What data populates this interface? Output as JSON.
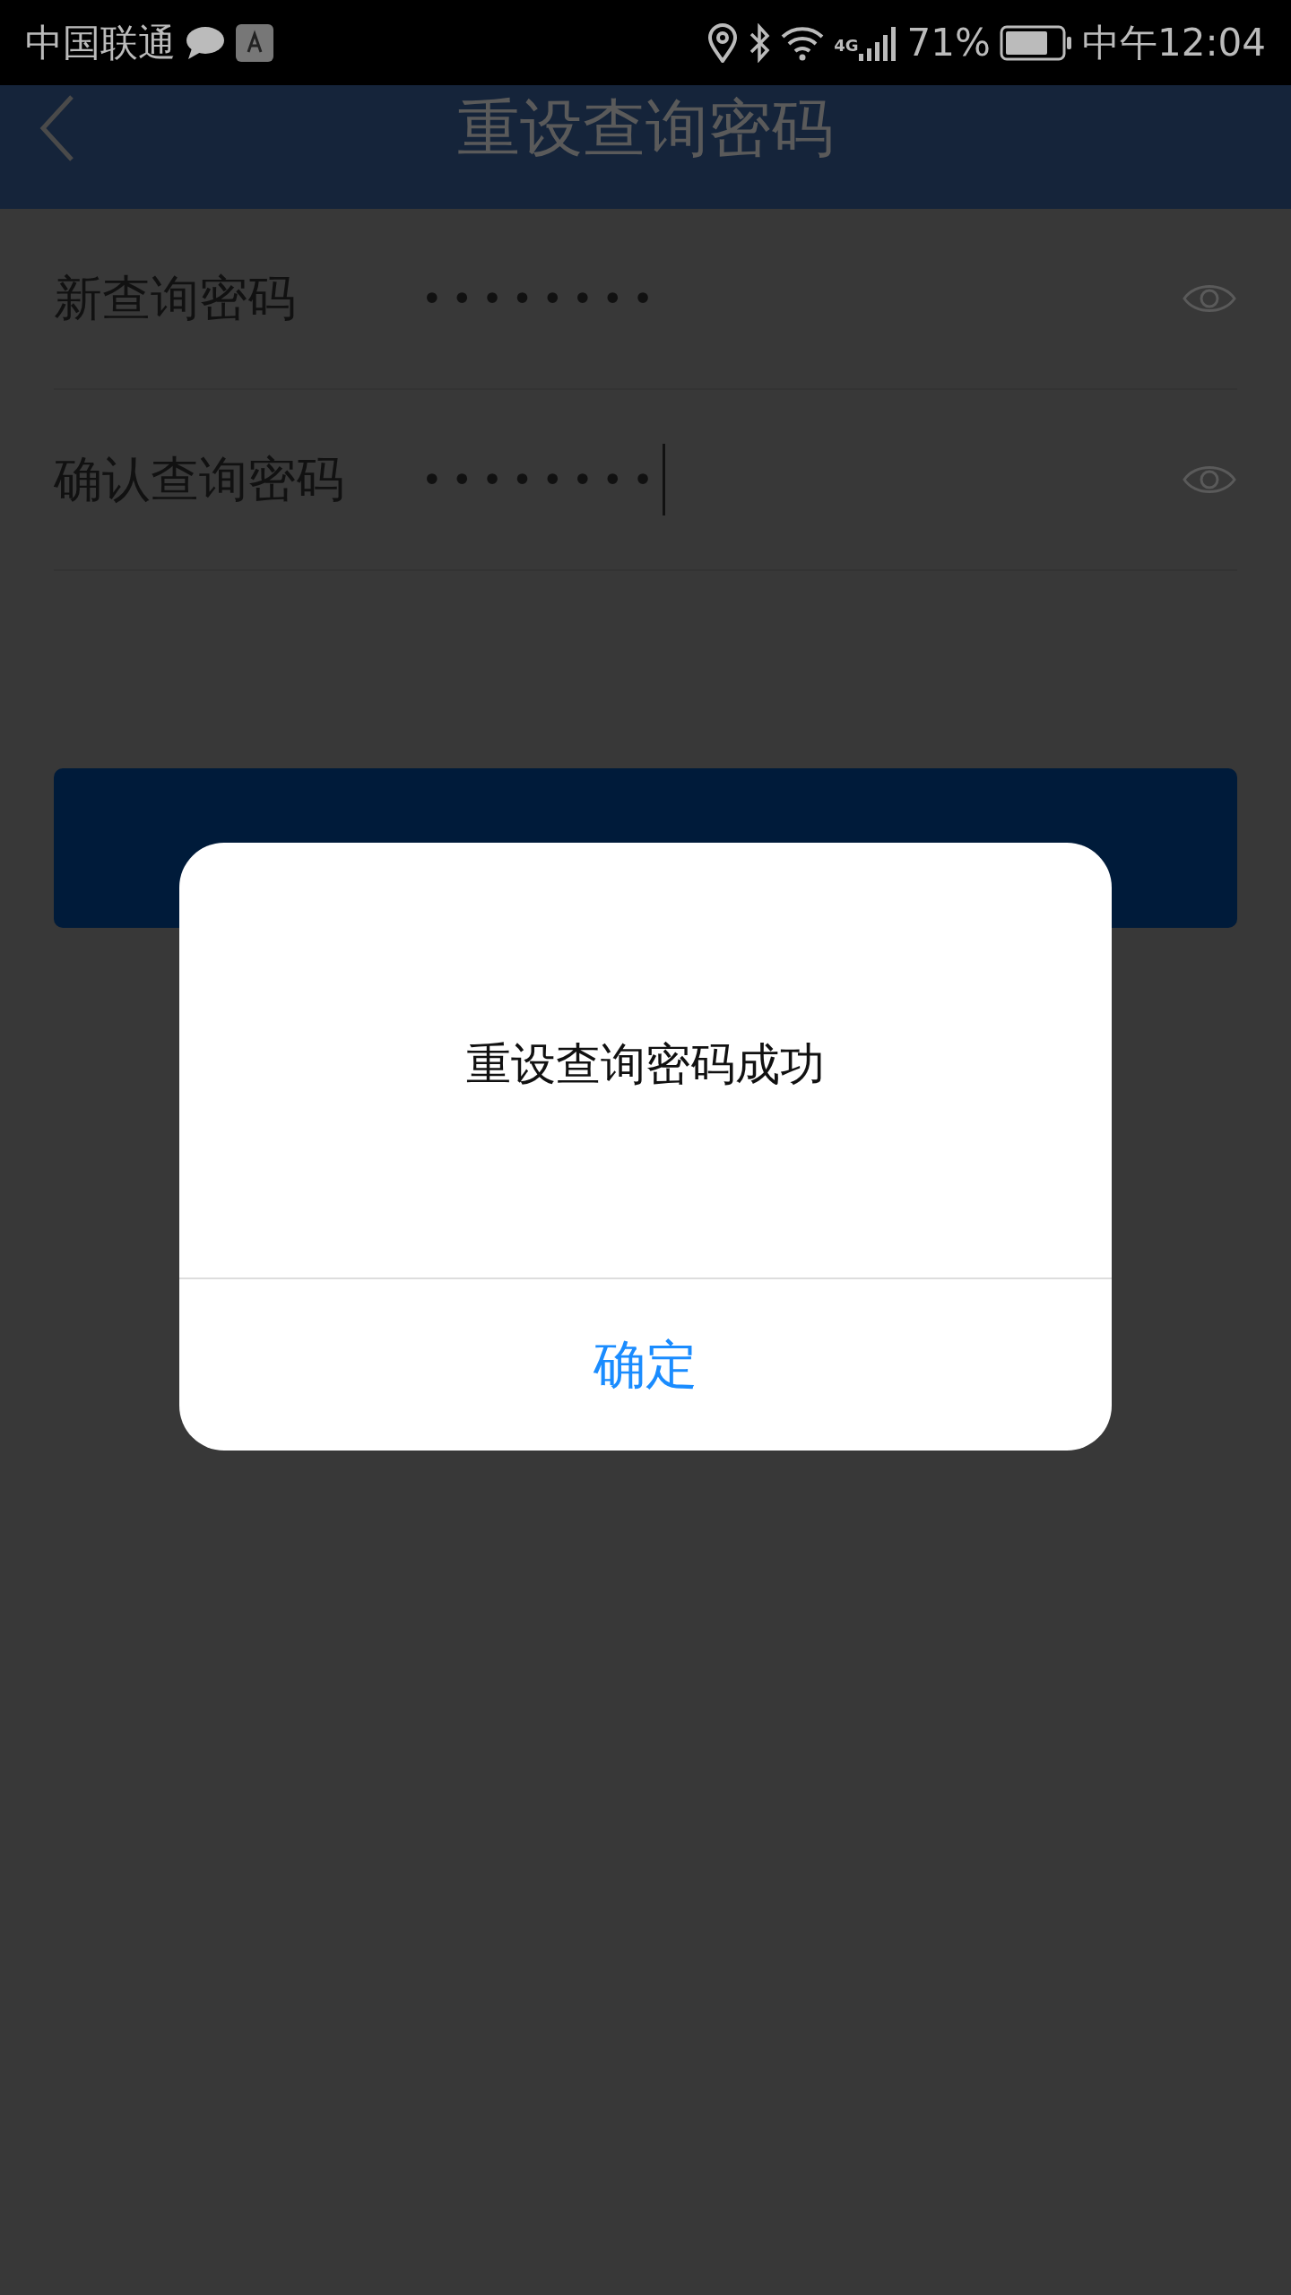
{
  "status_bar": {
    "carrier": "中国联通",
    "network": "4G",
    "battery": "71%",
    "time": "中午12:04"
  },
  "header": {
    "title": "重设查询密码"
  },
  "fields": [
    {
      "label": "新查询密码",
      "value": "••••••••",
      "focused": false
    },
    {
      "label": "确认查询密码",
      "value": "••••••••",
      "focused": true
    }
  ],
  "submit_button": {
    "kind": "button"
  },
  "dialog": {
    "message": "重设查询密码成功",
    "confirm": "确定"
  }
}
